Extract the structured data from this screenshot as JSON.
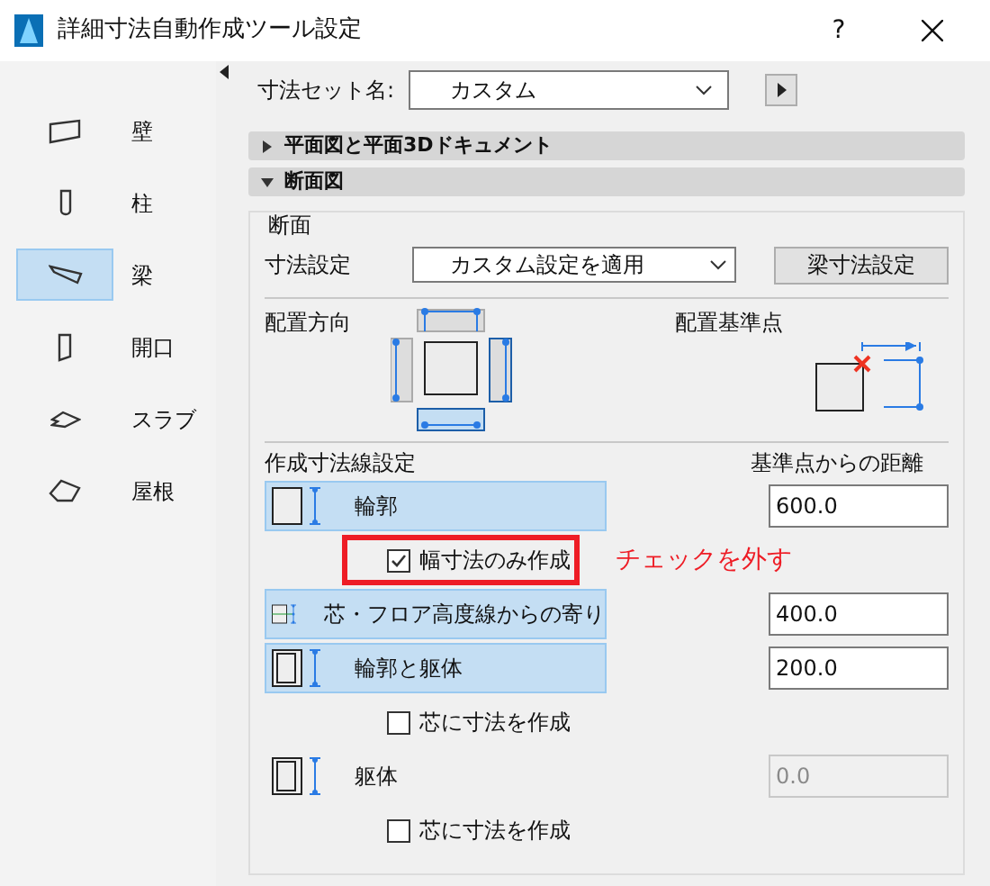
{
  "window": {
    "title": "詳細寸法自動作成ツール設定",
    "help": "?"
  },
  "sidebar": {
    "items": [
      {
        "label": "壁",
        "selected": false
      },
      {
        "label": "柱",
        "selected": false
      },
      {
        "label": "梁",
        "selected": true
      },
      {
        "label": "開口",
        "selected": false
      },
      {
        "label": "スラブ",
        "selected": false
      },
      {
        "label": "屋根",
        "selected": false
      }
    ]
  },
  "dimension_set": {
    "label": "寸法セット名:",
    "value": "カスタム"
  },
  "sections": [
    {
      "title": "平面図と平面3Dドキュメント",
      "expanded": false
    },
    {
      "title": "断面図",
      "expanded": true
    }
  ],
  "section_panel": {
    "group_title": "断面",
    "setting_label": "寸法設定",
    "setting_value": "カスタム設定を適用",
    "setting_button": "梁寸法設定",
    "placement_direction": "配置方向",
    "reference_point": "配置基準点",
    "lines_heading": "作成寸法線設定",
    "distance_heading": "基準点からの距離",
    "rows": [
      {
        "kind": "line",
        "label": "輪郭",
        "value": "600.0",
        "selected": true,
        "disabled": false
      },
      {
        "kind": "checkbox",
        "label": "幅寸法のみ作成",
        "checked": true,
        "highlighted": true
      },
      {
        "kind": "line",
        "label": "芯・フロア高度線からの寄り",
        "value": "400.0",
        "selected": true,
        "disabled": false
      },
      {
        "kind": "line",
        "label": "輪郭と躯体",
        "value": "200.0",
        "selected": true,
        "disabled": false
      },
      {
        "kind": "checkbox",
        "label": "芯に寸法を作成",
        "checked": false,
        "highlighted": false
      },
      {
        "kind": "line",
        "label": "躯体",
        "value": "0.0",
        "selected": false,
        "disabled": true
      },
      {
        "kind": "checkbox",
        "label": "芯に寸法を作成",
        "checked": false,
        "highlighted": false
      }
    ]
  },
  "annotation": "チェックを外す"
}
